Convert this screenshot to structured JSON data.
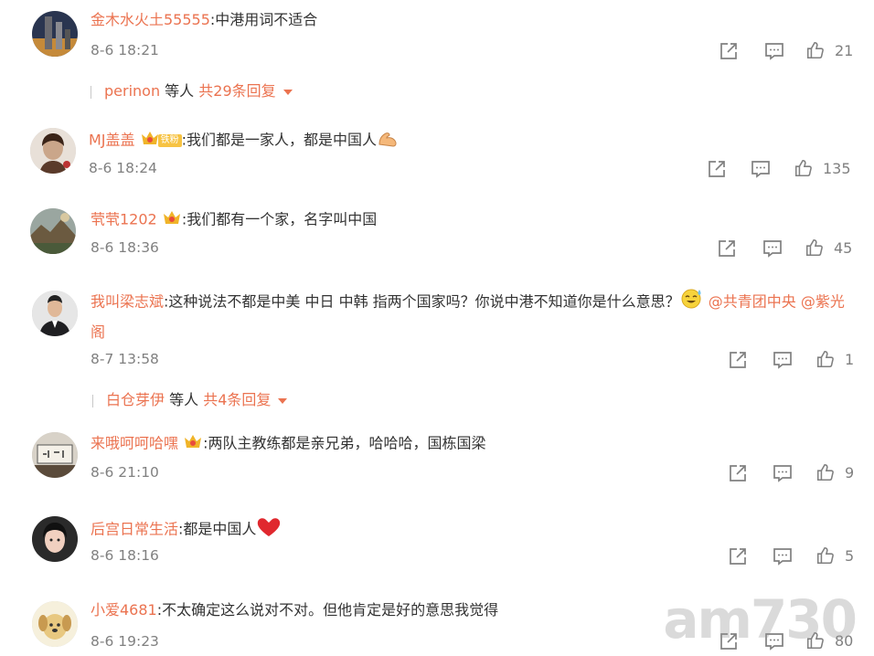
{
  "colors": {
    "username": "#eb7350",
    "meta": "#808080",
    "text": "#333333"
  },
  "comments": [
    {
      "user": "金木水火土55555",
      "text": ":中港用词不适合",
      "time": "8-6 18:21",
      "likes": "21",
      "reply": {
        "who": "perinon",
        "mid": " 等人 ",
        "total": "共29条回复"
      }
    },
    {
      "user": "MJ盖盖",
      "fan_badge": "铁粉",
      "text": ":我们都是一家人，都是中国人",
      "emoji": "flexed-biceps",
      "time": "8-6 18:24",
      "likes": "135"
    },
    {
      "user": "茕茕1202",
      "text": ":我们都有一个家，名字叫中国",
      "time": "8-6 18:36",
      "likes": "45"
    },
    {
      "user": "我叫梁志斌",
      "text": ":这种说法不都是中美 中日 中韩 指两个国家吗？你说中港不知道你是什么意思？",
      "emoji": "sweat-smile",
      "mention1": " @共青团中央",
      "mention2": " @紫光阁",
      "time": "8-7 13:58",
      "likes": "1",
      "reply": {
        "who": "白仓芽伊",
        "mid": " 等人 ",
        "total": "共4条回复"
      }
    },
    {
      "user": "来哦呵呵哈嘿",
      "text": ":两队主教练都是亲兄弟，哈哈哈，国栋国梁",
      "time": "8-6 21:10",
      "likes": "9"
    },
    {
      "user": "后宫日常生活",
      "text": ":都是中国人",
      "emoji": "red-heart",
      "time": "8-6 18:16",
      "likes": "5"
    },
    {
      "user": "小爱4681",
      "text": ":不太确定这么说对不对。但他肯定是好的意思我觉得",
      "time": "8-6 19:23",
      "likes": "80"
    }
  ],
  "watermark": "am730"
}
